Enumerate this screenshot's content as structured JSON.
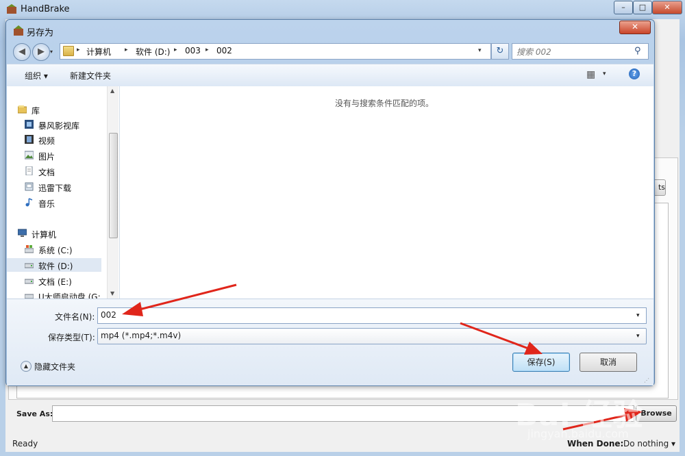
{
  "handbrake": {
    "title": "HandBrake",
    "minimize_glyph": "–",
    "maximize_glyph": "□",
    "close_glyph": "✕",
    "presets_btn_label": "ts",
    "save_as_label": "Save As:",
    "save_as_value": "",
    "browse_label": "Browse",
    "status": "Ready",
    "when_done_label": "When Done:",
    "when_done_value": "Do nothing ▾"
  },
  "dialog": {
    "title": "另存为",
    "close_glyph": "✕",
    "icon": "handbrake-app-icon",
    "nav": {
      "back_glyph": "◀",
      "forward_glyph": "▶",
      "recent_glyph": "▾",
      "refresh_glyph": "↻"
    },
    "breadcrumbs": [
      "计算机",
      "软件 (D:)",
      "003",
      "002"
    ],
    "breadcrumb_sep": "▸",
    "address_dropdown_glyph": "▾",
    "search_placeholder": "搜索 002",
    "search_icon": "magnifier-icon",
    "search_glyph": "⚲",
    "toolbar": {
      "organize": "组织 ▾",
      "new_folder": "新建文件夹",
      "view_glyph": "▦",
      "view_arrow": "▾",
      "help_glyph": "?"
    },
    "nav_pane": {
      "items": [
        {
          "label": "库",
          "icon": "library-icon",
          "group": true
        },
        {
          "label": "暴风影视库",
          "icon": "video-library-icon",
          "group": false
        },
        {
          "label": "视频",
          "icon": "video-icon",
          "group": false
        },
        {
          "label": "图片",
          "icon": "picture-icon",
          "group": false
        },
        {
          "label": "文档",
          "icon": "document-icon",
          "group": false
        },
        {
          "label": "迅雷下载",
          "icon": "download-icon",
          "group": false
        },
        {
          "label": "音乐",
          "icon": "music-icon",
          "group": false
        },
        {
          "label": "计算机",
          "icon": "computer-icon",
          "group": true
        },
        {
          "label": "系统 (C:)",
          "icon": "system-drive-icon",
          "group": false
        },
        {
          "label": "软件 (D:)",
          "icon": "drive-icon",
          "group": false,
          "selected": true
        },
        {
          "label": "文档 (E:)",
          "icon": "drive-icon",
          "group": false
        },
        {
          "label": "U大师启动盘 (G:",
          "icon": "usb-drive-icon",
          "group": false
        }
      ],
      "scroll_up_glyph": "▲",
      "scroll_down_glyph": "▼"
    },
    "empty_message": "没有与搜索条件匹配的项。",
    "filename_label": "文件名(N):",
    "filename_value": "002",
    "filetype_label": "保存类型(T):",
    "filetype_value": "mp4 (*.mp4;*.m4v)",
    "dropdown_glyph": "▾",
    "hide_folders_label": "隐藏文件夹",
    "hide_folders_glyph": "▲",
    "save_label": "保存(S)",
    "cancel_label": "取消",
    "grip_glyph": "⋰"
  },
  "annotations": {
    "color": "#e0261b",
    "arrow_count": 3
  },
  "watermark": {
    "logo": "Bai 经验",
    "url": "jingyan.baidu.com"
  }
}
